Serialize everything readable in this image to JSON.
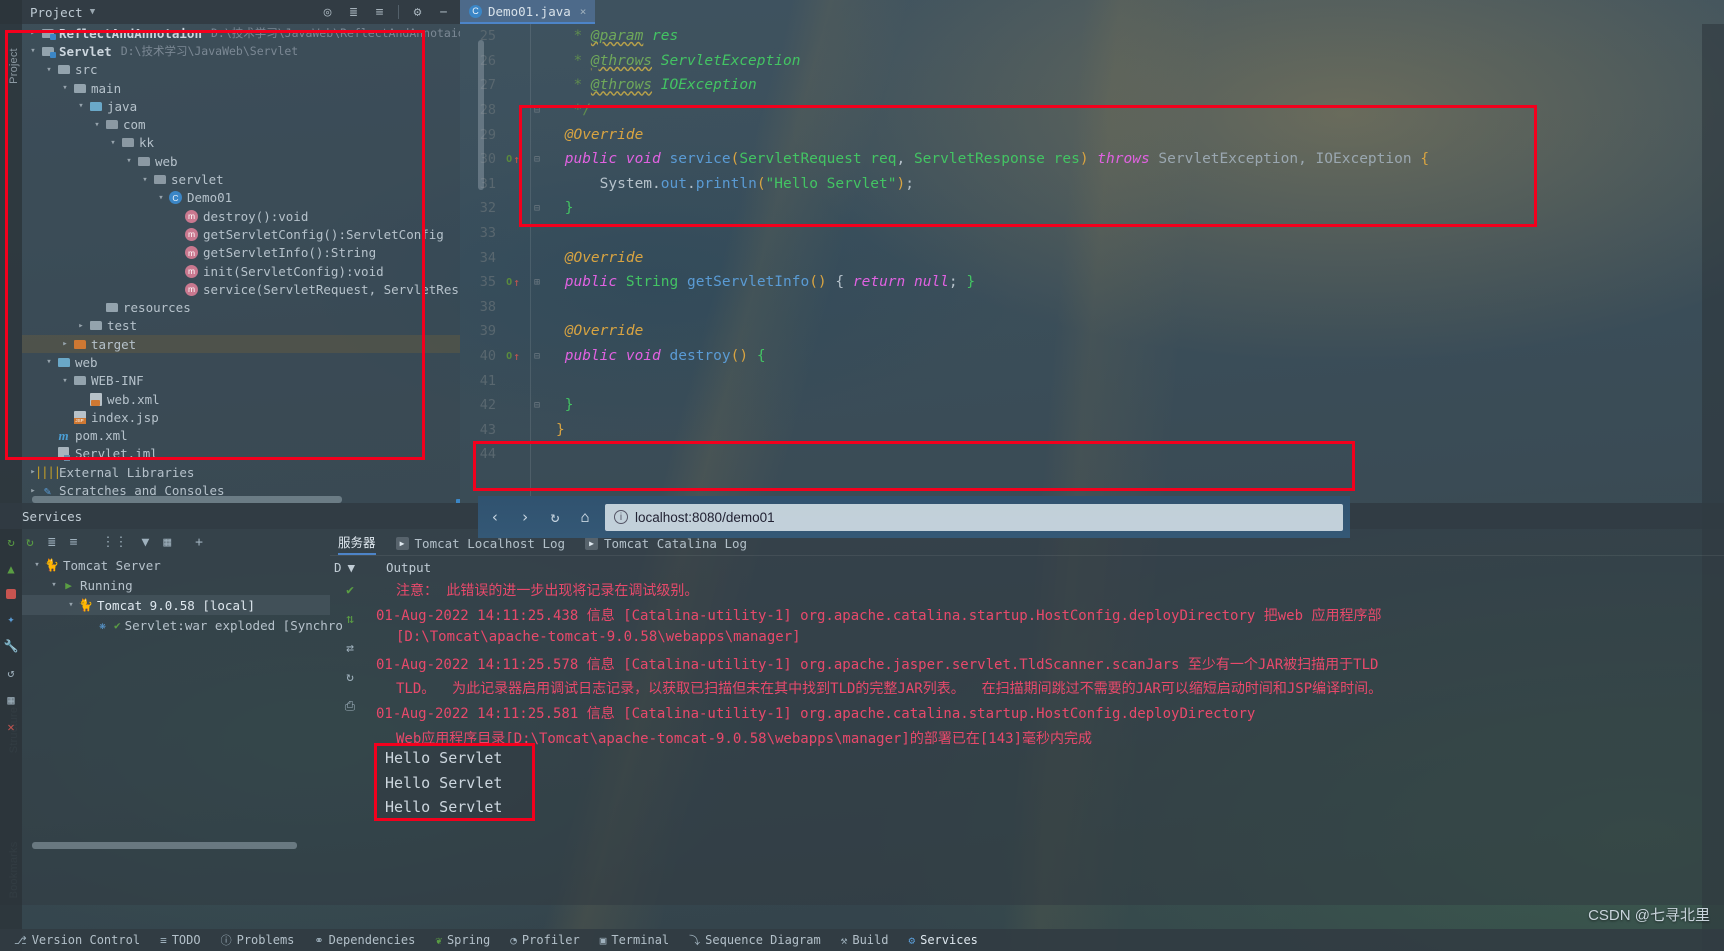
{
  "window": {
    "project_tool_title": "Project",
    "services_title": "Services"
  },
  "project_toolbar": {
    "icons": [
      "locate-icon",
      "expand-all-icon",
      "collapse-all-icon",
      "gear-icon",
      "hide-icon"
    ]
  },
  "editor_tabs": [
    {
      "label": "Demo01.java",
      "icon": "java-class-icon",
      "close": "×",
      "active": true
    }
  ],
  "left_strip_labels": [
    "Project",
    "Structure",
    "Bookmarks"
  ],
  "project_tree": [
    {
      "depth": 0,
      "arrow": "›",
      "icon": "module-icon",
      "label": "ReflectAndAnnotaion",
      "path": "D:\\技术学习\\JavaWeb\\ReflectAndAnnotaion",
      "bold": true,
      "selected": false
    },
    {
      "depth": 0,
      "arrow": "⌄",
      "icon": "module-icon",
      "label": "Servlet",
      "path": "D:\\技术学习\\JavaWeb\\Servlet",
      "bold": true,
      "selected": false
    },
    {
      "depth": 1,
      "arrow": "⌄",
      "icon": "folder-icon",
      "label": "src",
      "path": "",
      "bold": false,
      "selected": false
    },
    {
      "depth": 2,
      "arrow": "⌄",
      "icon": "folder-icon",
      "label": "main",
      "path": "",
      "bold": false,
      "selected": false
    },
    {
      "depth": 3,
      "arrow": "⌄",
      "icon": "source-folder-icon",
      "label": "java",
      "path": "",
      "bold": false,
      "selected": false
    },
    {
      "depth": 4,
      "arrow": "⌄",
      "icon": "package-icon",
      "label": "com",
      "path": "",
      "bold": false,
      "selected": false
    },
    {
      "depth": 5,
      "arrow": "⌄",
      "icon": "package-icon",
      "label": "kk",
      "path": "",
      "bold": false,
      "selected": false
    },
    {
      "depth": 6,
      "arrow": "⌄",
      "icon": "package-icon",
      "label": "web",
      "path": "",
      "bold": false,
      "selected": false
    },
    {
      "depth": 7,
      "arrow": "⌄",
      "icon": "package-icon",
      "label": "servlet",
      "path": "",
      "bold": false,
      "selected": false
    },
    {
      "depth": 8,
      "arrow": "⌄",
      "icon": "java-class-icon",
      "label": "Demo01",
      "path": "",
      "bold": false,
      "selected": false
    },
    {
      "depth": 9,
      "arrow": "",
      "icon": "method-icon",
      "label": "destroy():void",
      "path": "",
      "bold": false,
      "selected": false
    },
    {
      "depth": 9,
      "arrow": "",
      "icon": "method-icon",
      "label": "getServletConfig():ServletConfig",
      "path": "",
      "bold": false,
      "selected": false
    },
    {
      "depth": 9,
      "arrow": "",
      "icon": "method-icon",
      "label": "getServletInfo():String",
      "path": "",
      "bold": false,
      "selected": false
    },
    {
      "depth": 9,
      "arrow": "",
      "icon": "method-icon",
      "label": "init(ServletConfig):void",
      "path": "",
      "bold": false,
      "selected": false
    },
    {
      "depth": 9,
      "arrow": "",
      "icon": "method-icon",
      "label": "service(ServletRequest, ServletResp",
      "path": "",
      "bold": false,
      "selected": false
    },
    {
      "depth": 4,
      "arrow": "",
      "icon": "resources-folder-icon",
      "label": "resources",
      "path": "",
      "bold": false,
      "selected": false
    },
    {
      "depth": 3,
      "arrow": "›",
      "icon": "folder-icon",
      "label": "test",
      "path": "",
      "bold": false,
      "selected": false
    },
    {
      "depth": 2,
      "arrow": "›",
      "icon": "target-folder-icon",
      "label": "target",
      "path": "",
      "bold": false,
      "selected": true
    },
    {
      "depth": 1,
      "arrow": "⌄",
      "icon": "web-folder-icon",
      "label": "web",
      "path": "",
      "bold": false,
      "selected": false
    },
    {
      "depth": 2,
      "arrow": "⌄",
      "icon": "folder-icon",
      "label": "WEB-INF",
      "path": "",
      "bold": false,
      "selected": false
    },
    {
      "depth": 3,
      "arrow": "",
      "icon": "xml-file-icon",
      "label": "web.xml",
      "path": "",
      "bold": false,
      "selected": false
    },
    {
      "depth": 2,
      "arrow": "",
      "icon": "jsp-file-icon",
      "label": "index.jsp",
      "path": "",
      "bold": false,
      "selected": false
    },
    {
      "depth": 1,
      "arrow": "",
      "icon": "maven-file-icon",
      "label": "pom.xml",
      "path": "",
      "bold": false,
      "selected": false
    },
    {
      "depth": 1,
      "arrow": "",
      "icon": "iml-file-icon",
      "label": "Servlet.iml",
      "path": "",
      "bold": false,
      "selected": false
    },
    {
      "depth": 0,
      "arrow": "›",
      "icon": "library-icon",
      "label": "External Libraries",
      "path": "",
      "bold": false,
      "selected": false
    },
    {
      "depth": 0,
      "arrow": "›",
      "icon": "scratch-icon",
      "label": "Scratches and Consoles",
      "path": "",
      "bold": false,
      "selected": false
    }
  ],
  "editor_code": [
    {
      "num": "25",
      "marker": "",
      "fold": "",
      "segments": [
        {
          "t": "  * ",
          "c": "cmt"
        },
        {
          "t": "@param",
          "c": "cmt-tag"
        },
        {
          "t": " res",
          "c": "cmt-type"
        }
      ]
    },
    {
      "num": "26",
      "marker": "",
      "fold": "",
      "segments": [
        {
          "t": "  * ",
          "c": "cmt"
        },
        {
          "t": "@throws",
          "c": "cmt-tag"
        },
        {
          "t": " ServletException",
          "c": "cmt-type"
        }
      ]
    },
    {
      "num": "27",
      "marker": "",
      "fold": "",
      "segments": [
        {
          "t": "  * ",
          "c": "cmt"
        },
        {
          "t": "@throws",
          "c": "cmt-tag"
        },
        {
          "t": " IOException",
          "c": "cmt-type"
        }
      ]
    },
    {
      "num": "28",
      "marker": "",
      "fold": "⊟",
      "segments": [
        {
          "t": "  */",
          "c": "cmt"
        }
      ]
    },
    {
      "num": "29",
      "marker": "",
      "fold": "",
      "segments": [
        {
          "t": " @Override",
          "c": "ann"
        }
      ]
    },
    {
      "num": "30",
      "marker": "override",
      "fold": "⊟",
      "segments": [
        {
          "t": " ",
          "c": "pun"
        },
        {
          "t": "public void",
          "c": "kw-it"
        },
        {
          "t": " ",
          "c": "pun"
        },
        {
          "t": "service",
          "c": "mth"
        },
        {
          "t": "(",
          "c": "ylw"
        },
        {
          "t": "ServletRequest req",
          "c": "typ"
        },
        {
          "t": ", ",
          "c": "pun"
        },
        {
          "t": "ServletResponse res",
          "c": "typ"
        },
        {
          "t": ") ",
          "c": "ylw"
        },
        {
          "t": "throws",
          "c": "kw-it"
        },
        {
          "t": " ServletException, IOException ",
          "c": "gray"
        },
        {
          "t": "{",
          "c": "ylw"
        }
      ]
    },
    {
      "num": "31",
      "marker": "",
      "fold": "",
      "segments": [
        {
          "t": "     System",
          "c": "pun"
        },
        {
          "t": ".",
          "c": "pun"
        },
        {
          "t": "out",
          "c": "mth"
        },
        {
          "t": ".",
          "c": "pun"
        },
        {
          "t": "println",
          "c": "mth"
        },
        {
          "t": "(",
          "c": "ylw"
        },
        {
          "t": "\"Hello Servlet\"",
          "c": "str"
        },
        {
          "t": ")",
          "c": "ylw"
        },
        {
          "t": ";",
          "c": "pun"
        }
      ]
    },
    {
      "num": "32",
      "marker": "",
      "fold": "⊟",
      "segments": [
        {
          "t": " }",
          "c": "typ"
        }
      ]
    },
    {
      "num": "33",
      "marker": "",
      "fold": "",
      "segments": [
        {
          "t": "",
          "c": "pun"
        }
      ]
    },
    {
      "num": "34",
      "marker": "",
      "fold": "",
      "segments": [
        {
          "t": " @Override",
          "c": "ann"
        }
      ]
    },
    {
      "num": "35",
      "marker": "override",
      "fold": "⊞",
      "segments": [
        {
          "t": " ",
          "c": "pun"
        },
        {
          "t": "public",
          "c": "kw-it"
        },
        {
          "t": " ",
          "c": "pun"
        },
        {
          "t": "String",
          "c": "typ"
        },
        {
          "t": " ",
          "c": "pun"
        },
        {
          "t": "getServletInfo",
          "c": "mth"
        },
        {
          "t": "()",
          "c": "ylw"
        },
        {
          "t": " { ",
          "c": "pun"
        },
        {
          "t": "return null",
          "c": "kw-it"
        },
        {
          "t": "; ",
          "c": "pun"
        },
        {
          "t": "}",
          "c": "typ"
        }
      ]
    },
    {
      "num": "38",
      "marker": "",
      "fold": "",
      "segments": [
        {
          "t": "",
          "c": "pun"
        }
      ]
    },
    {
      "num": "39",
      "marker": "",
      "fold": "",
      "segments": [
        {
          "t": " @Override",
          "c": "ann"
        }
      ]
    },
    {
      "num": "40",
      "marker": "override",
      "fold": "⊟",
      "segments": [
        {
          "t": " ",
          "c": "pun"
        },
        {
          "t": "public void",
          "c": "kw-it"
        },
        {
          "t": " ",
          "c": "pun"
        },
        {
          "t": "destroy",
          "c": "mth"
        },
        {
          "t": "() ",
          "c": "ylw"
        },
        {
          "t": "{",
          "c": "typ"
        }
      ]
    },
    {
      "num": "41",
      "marker": "",
      "fold": "",
      "segments": [
        {
          "t": "",
          "c": "pun"
        }
      ]
    },
    {
      "num": "42",
      "marker": "",
      "fold": "⊟",
      "segments": [
        {
          "t": " }",
          "c": "typ"
        }
      ]
    },
    {
      "num": "43",
      "marker": "",
      "fold": "",
      "segments": [
        {
          "t": "}",
          "c": "ylw"
        }
      ]
    },
    {
      "num": "44",
      "marker": "",
      "fold": "",
      "segments": [
        {
          "t": "",
          "c": "pun"
        }
      ]
    }
  ],
  "browser": {
    "back_icon": "back-arrow-icon",
    "forward_icon": "forward-arrow-icon",
    "reload_icon": "reload-icon",
    "home_icon": "home-icon",
    "info_icon": "info-icon",
    "url": "localhost:8080/demo01"
  },
  "services": {
    "toolbar_icons": [
      "rerun-icon",
      "expand-all-icon",
      "collapse-all-icon",
      "group-icon",
      "filter-icon",
      "chart-icon",
      "add-icon"
    ],
    "iconbar": [
      "rerun-icon",
      "run-icon",
      "stop-icon",
      "debug-icon",
      "settings-icon",
      "restart-icon",
      "layout-icon",
      "close-icon"
    ],
    "tree": [
      {
        "depth": 0,
        "arrow": "⌄",
        "icon": "tomcat-icon",
        "label": "Tomcat Server",
        "selected": false
      },
      {
        "depth": 1,
        "arrow": "⌄",
        "icon": "run-icon",
        "label": "Running",
        "selected": false
      },
      {
        "depth": 2,
        "arrow": "⌄",
        "icon": "tomcat-icon",
        "label": "Tomcat 9.0.58 [local]",
        "selected": true
      },
      {
        "depth": 3,
        "arrow": "",
        "icon": "artifact-icon",
        "label": "Servlet:war exploded [Synchro",
        "selected": false
      }
    ],
    "log_tabs": [
      {
        "label": "服务器",
        "icon": "",
        "active": true
      },
      {
        "label": "Tomcat Localhost Log",
        "icon": "play-icon",
        "active": false
      },
      {
        "label": "Tomcat Catalina Log",
        "icon": "play-icon",
        "active": false
      }
    ],
    "output_header": {
      "dropdown": "D",
      "label": "Output"
    },
    "log_gutter_icons": [
      "check-icon",
      "scroll-icon",
      "up-down-icon",
      "refresh-icon",
      "print-icon"
    ],
    "log_lines": [
      {
        "indent": true,
        "text": "注意： 此错误的进一步出现将记录在调试级别。"
      },
      {
        "indent": false,
        "text": "01-Aug-2022 14:11:25.438 信息 [Catalina-utility-1] org.apache.catalina.startup.HostConfig.deployDirectory 把web 应用程序部"
      },
      {
        "indent": true,
        "text": "[D:\\Tomcat\\apache-tomcat-9.0.58\\webapps\\manager]"
      },
      {
        "indent": false,
        "text": "01-Aug-2022 14:11:25.578 信息 [Catalina-utility-1] org.apache.jasper.servlet.TldScanner.scanJars 至少有一个JAR被扫描用于TLD"
      },
      {
        "indent": true,
        "text": "TLD。  为此记录器启用调试日志记录，以获取已扫描但未在其中找到TLD的完整JAR列表。  在扫描期间跳过不需要的JAR可以缩短启动时间和JSP编译时间。"
      },
      {
        "indent": false,
        "text": "01-Aug-2022 14:11:25.581 信息 [Catalina-utility-1] org.apache.catalina.startup.HostConfig.deployDirectory"
      },
      {
        "indent": true,
        "text": "Web应用程序目录[D:\\Tomcat\\apache-tomcat-9.0.58\\webapps\\manager]的部署已在[143]毫秒内完成"
      }
    ],
    "console_output": [
      "Hello Servlet",
      "Hello Servlet",
      "Hello Servlet"
    ]
  },
  "statusbar": [
    {
      "icon": "version-control-icon",
      "label": "Version Control"
    },
    {
      "icon": "todo-icon",
      "label": "TODO"
    },
    {
      "icon": "problems-icon",
      "label": "Problems"
    },
    {
      "icon": "dependencies-icon",
      "label": "Dependencies"
    },
    {
      "icon": "spring-icon",
      "label": "Spring"
    },
    {
      "icon": "profiler-icon",
      "label": "Profiler"
    },
    {
      "icon": "terminal-icon",
      "label": "Terminal"
    },
    {
      "icon": "sequence-diagram-icon",
      "label": "Sequence Diagram"
    },
    {
      "icon": "build-icon",
      "label": "Build"
    },
    {
      "icon": "services-icon",
      "label": "Services"
    }
  ],
  "watermark": "CSDN @七寻北里",
  "colors": {
    "annotation_red": "#f3001d",
    "accent_blue": "#4d84c8",
    "log_red": "#e8496b",
    "string_green": "#43c463"
  }
}
